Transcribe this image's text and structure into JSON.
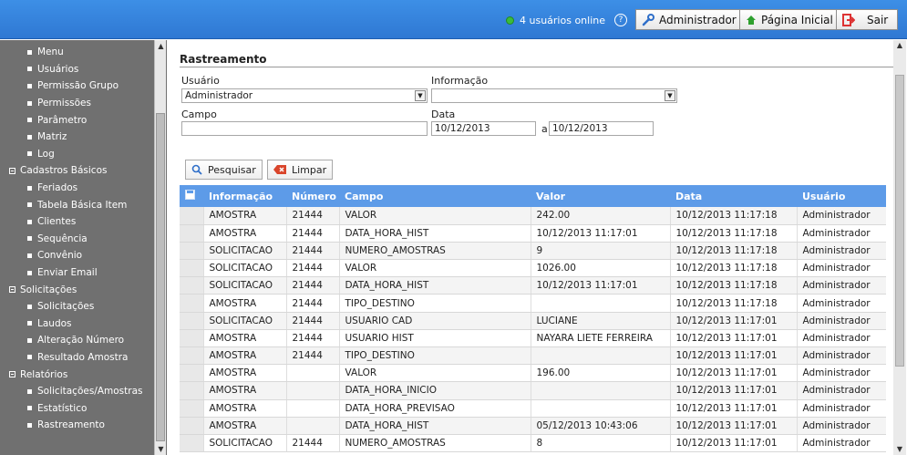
{
  "header": {
    "online_text": "4 usuários online",
    "help_glyph": "?",
    "admin_label": "Administrador",
    "home_label": "Página Inicial",
    "exit_label": "Sair",
    "colors": {
      "bar": "#2f78d3",
      "online_dot": "#3bbb3b",
      "table_header": "#5d9be8"
    }
  },
  "sidebar": {
    "items": [
      {
        "label": "Menu",
        "type": "sub"
      },
      {
        "label": "Usuários",
        "type": "sub"
      },
      {
        "label": "Permissão Grupo",
        "type": "sub"
      },
      {
        "label": "Permissões",
        "type": "sub"
      },
      {
        "label": "Parâmetro",
        "type": "sub"
      },
      {
        "label": "Matriz",
        "type": "sub"
      },
      {
        "label": "Log",
        "type": "sub"
      },
      {
        "label": "Cadastros Básicos",
        "type": "group"
      },
      {
        "label": "Feriados",
        "type": "sub"
      },
      {
        "label": "Tabela Básica Item",
        "type": "sub"
      },
      {
        "label": "Clientes",
        "type": "sub"
      },
      {
        "label": "Sequência",
        "type": "sub"
      },
      {
        "label": "Convênio",
        "type": "sub"
      },
      {
        "label": "Enviar Email",
        "type": "sub"
      },
      {
        "label": "Solicitações",
        "type": "group"
      },
      {
        "label": "Solicitações",
        "type": "sub"
      },
      {
        "label": "Laudos",
        "type": "sub"
      },
      {
        "label": "Alteração Número",
        "type": "sub"
      },
      {
        "label": "Resultado Amostra",
        "type": "sub"
      },
      {
        "label": "Relatórios",
        "type": "group"
      },
      {
        "label": "Solicitações/Amostras",
        "type": "sub"
      },
      {
        "label": "Estatístico",
        "type": "sub"
      },
      {
        "label": "Rastreamento",
        "type": "sub"
      }
    ]
  },
  "form": {
    "title": "Rastreamento",
    "usuario_label": "Usuário",
    "usuario_value": "Administrador",
    "informacao_label": "Informação",
    "informacao_value": "",
    "campo_label": "Campo",
    "campo_value": "",
    "data_label": "Data",
    "data_from": "10/12/2013",
    "data_sep": "a",
    "data_to": "10/12/2013",
    "search_label": "Pesquisar",
    "clear_label": "Limpar"
  },
  "table": {
    "headers": [
      "Informação",
      "Número",
      "Campo",
      "Valor",
      "Data",
      "Usuário"
    ],
    "rows": [
      [
        "AMOSTRA",
        "21444",
        "VALOR",
        "242.00",
        "10/12/2013 11:17:18",
        "Administrador"
      ],
      [
        "AMOSTRA",
        "21444",
        "DATA_HORA_HIST",
        "10/12/2013 11:17:01",
        "10/12/2013 11:17:18",
        "Administrador"
      ],
      [
        "SOLICITACAO",
        "21444",
        "NUMERO_AMOSTRAS",
        "9",
        "10/12/2013 11:17:18",
        "Administrador"
      ],
      [
        "SOLICITACAO",
        "21444",
        "VALOR",
        "1026.00",
        "10/12/2013 11:17:18",
        "Administrador"
      ],
      [
        "SOLICITACAO",
        "21444",
        "DATA_HORA_HIST",
        "10/12/2013 11:17:01",
        "10/12/2013 11:17:18",
        "Administrador"
      ],
      [
        "AMOSTRA",
        "21444",
        "TIPO_DESTINO",
        "",
        "10/12/2013 11:17:18",
        "Administrador"
      ],
      [
        "SOLICITACAO",
        "21444",
        "USUARIO CAD",
        "LUCIANE",
        "10/12/2013 11:17:01",
        "Administrador"
      ],
      [
        "AMOSTRA",
        "21444",
        "USUARIO HIST",
        "NAYARA LIETE FERREIRA",
        "10/12/2013 11:17:01",
        "Administrador"
      ],
      [
        "AMOSTRA",
        "21444",
        "TIPO_DESTINO",
        "",
        "10/12/2013 11:17:01",
        "Administrador"
      ],
      [
        "AMOSTRA",
        "",
        "VALOR",
        "196.00",
        "10/12/2013 11:17:01",
        "Administrador"
      ],
      [
        "AMOSTRA",
        "",
        "DATA_HORA_INICIO",
        "",
        "10/12/2013 11:17:01",
        "Administrador"
      ],
      [
        "AMOSTRA",
        "",
        "DATA_HORA_PREVISAO",
        "",
        "10/12/2013 11:17:01",
        "Administrador"
      ],
      [
        "AMOSTRA",
        "",
        "DATA_HORA_HIST",
        "05/12/2013 10:43:06",
        "10/12/2013 11:17:01",
        "Administrador"
      ],
      [
        "SOLICITACAO",
        "21444",
        "NUMERO_AMOSTRAS",
        "8",
        "10/12/2013 11:17:01",
        "Administrador"
      ]
    ]
  }
}
